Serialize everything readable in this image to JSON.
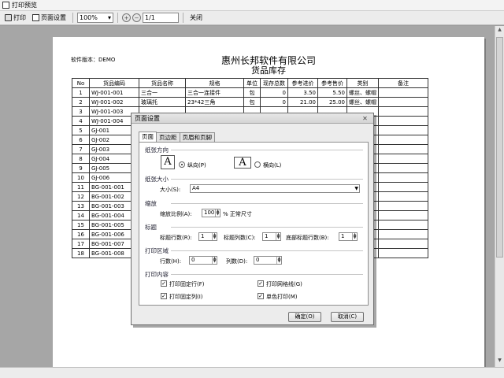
{
  "window": {
    "title": "打印预览"
  },
  "toolbar": {
    "print_label": "打印",
    "page_setup_label": "页面设置",
    "zoom_value": "100%",
    "page_value": "1/1",
    "close_label": "关闭"
  },
  "report": {
    "version_label": "软件版本：DEMO",
    "company": "惠州长邦软件有限公司",
    "subtitle": "货品库存",
    "headers": [
      "No",
      "货品编码",
      "货品名称",
      "规格",
      "单位",
      "现存总数",
      "参考进价",
      "参考售价",
      "类别",
      "备注"
    ],
    "rows": [
      [
        "1",
        "WJ-001-001",
        "三合一",
        "三合一连接件",
        "包",
        "0",
        "3.50",
        "5.50",
        "螺丝、螺帽",
        ""
      ],
      [
        "2",
        "WJ-001-002",
        "玻璃托",
        "23*42三角",
        "包",
        "0",
        "21.00",
        "25.00",
        "螺丝、螺帽",
        ""
      ],
      [
        "3",
        "WJ-001-003",
        "",
        "",
        "",
        "",
        "",
        "",
        "",
        ""
      ],
      [
        "4",
        "WJ-001-004",
        "",
        "",
        "",
        "",
        "",
        "",
        "",
        ""
      ],
      [
        "5",
        "GJ-001",
        "",
        "",
        "",
        "",
        "",
        "",
        "",
        ""
      ],
      [
        "6",
        "GJ-002",
        "",
        "",
        "",
        "",
        "",
        "",
        "",
        ""
      ],
      [
        "7",
        "GJ-003",
        "",
        "",
        "",
        "",
        "",
        "",
        "",
        ""
      ],
      [
        "8",
        "GJ-004",
        "",
        "",
        "",
        "",
        "",
        "",
        "",
        ""
      ],
      [
        "9",
        "GJ-005",
        "",
        "",
        "",
        "",
        "",
        "",
        "",
        ""
      ],
      [
        "10",
        "GJ-006",
        "",
        "",
        "",
        "",
        "",
        "",
        "",
        ""
      ],
      [
        "11",
        "BG-001-001",
        "",
        "",
        "",
        "",
        "",
        "",
        "",
        ""
      ],
      [
        "12",
        "BG-001-002",
        "",
        "",
        "",
        "",
        "",
        "",
        "",
        ""
      ],
      [
        "13",
        "BG-001-003",
        "",
        "",
        "",
        "",
        "",
        "",
        "",
        ""
      ],
      [
        "14",
        "BG-001-004",
        "",
        "",
        "",
        "",
        "",
        "",
        "",
        ""
      ],
      [
        "15",
        "BG-001-005",
        "",
        "",
        "",
        "",
        "",
        "",
        "",
        ""
      ],
      [
        "16",
        "BG-001-006",
        "",
        "",
        "",
        "",
        "",
        "",
        "",
        ""
      ],
      [
        "17",
        "BG-001-007",
        "",
        "",
        "",
        "",
        "",
        "",
        "",
        ""
      ],
      [
        "18",
        "BG-001-008",
        "",
        "",
        "",
        "",
        "",
        "",
        "",
        ""
      ]
    ]
  },
  "dialog": {
    "title": "页面设置",
    "tabs": [
      "页面",
      "页边距",
      "页眉和页脚"
    ],
    "orientation": {
      "section": "纸张方向",
      "portrait_label": "纵向(P)",
      "landscape_label": "横向(L)",
      "selected": "portrait"
    },
    "paper": {
      "section": "纸张大小",
      "size_label": "大小(S):",
      "size_value": "A4"
    },
    "scale": {
      "section": "缩放",
      "ratio_label": "缩放比例(A):",
      "ratio_value": "100",
      "unit_label": "% 正常尺寸"
    },
    "titles": {
      "section": "标题",
      "title_rows_label": "标题行数(R):",
      "title_rows_value": "1",
      "title_cols_label": "标题列数(C):",
      "title_cols_value": "1",
      "bottom_rows_label": "底部标题行数(B):",
      "bottom_rows_value": "1"
    },
    "print_area": {
      "section": "打印区域",
      "rows_label": "行数(H):",
      "rows_value": "0",
      "cols_label": "列数(D):",
      "cols_value": "0"
    },
    "content": {
      "section": "打印内容",
      "fixed_rows_label": "打印固定行(F)",
      "fixed_rows_checked": true,
      "grid_label": "打印网格线(G)",
      "grid_checked": true,
      "fixed_cols_label": "打印固定列(I)",
      "fixed_cols_checked": true,
      "mono_label": "单色打印(M)",
      "mono_checked": true
    },
    "ok_label": "确定(O)",
    "cancel_label": "取消(C)"
  }
}
